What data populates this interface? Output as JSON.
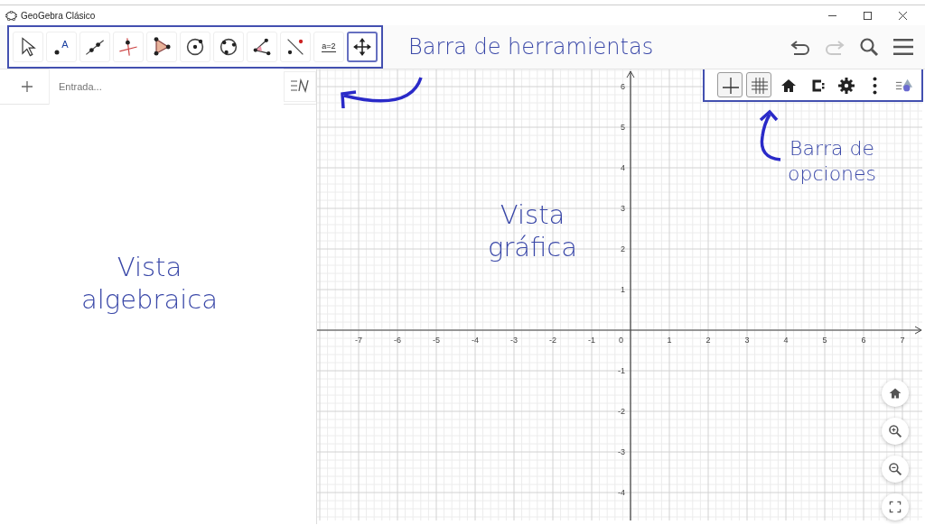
{
  "window": {
    "title": "GeoGebra Clásico"
  },
  "toolbar": {
    "tools": [
      {
        "kind": "pointer",
        "selected": false
      },
      {
        "kind": "point",
        "selected": false,
        "label": "A"
      },
      {
        "kind": "line",
        "selected": false
      },
      {
        "kind": "perpendicular",
        "selected": false
      },
      {
        "kind": "polygon",
        "selected": false
      },
      {
        "kind": "circle",
        "selected": false
      },
      {
        "kind": "circle3",
        "selected": false
      },
      {
        "kind": "angle",
        "selected": false
      },
      {
        "kind": "reflect",
        "selected": false
      },
      {
        "kind": "slider",
        "selected": false,
        "label": "a=2"
      },
      {
        "kind": "move_view",
        "selected": true
      }
    ],
    "actions": [
      {
        "kind": "undo",
        "disabled": false
      },
      {
        "kind": "redo",
        "disabled": true
      },
      {
        "kind": "search",
        "disabled": false
      },
      {
        "kind": "menu",
        "disabled": false
      }
    ]
  },
  "algebra_view": {
    "input": {
      "placeholder": "Entrada..."
    }
  },
  "graphics_view": {
    "x_ticks": [
      "-7",
      "-6",
      "-5",
      "-4",
      "-3",
      "-2",
      "-1",
      "1",
      "2",
      "3",
      "4",
      "5",
      "6",
      "7"
    ],
    "y_ticks": [
      "6",
      "5",
      "4",
      "3",
      "2",
      "1",
      "-1",
      "-2",
      "-3",
      "-4"
    ],
    "origin_label": "0",
    "style_bar": [
      {
        "kind": "axes",
        "on": true
      },
      {
        "kind": "grid",
        "on": true
      },
      {
        "kind": "home",
        "on": false
      },
      {
        "kind": "capture",
        "on": false
      },
      {
        "kind": "settings",
        "on": false
      },
      {
        "kind": "more",
        "on": false
      },
      {
        "kind": "toggle",
        "on": false
      }
    ],
    "zoom_buttons": [
      {
        "kind": "home"
      },
      {
        "kind": "zoom_in"
      },
      {
        "kind": "zoom_out"
      },
      {
        "kind": "fullscreen"
      }
    ]
  },
  "annotations": [
    {
      "kind": "toolbar",
      "text": "Barra de herramientas"
    },
    {
      "kind": "options",
      "lines": [
        "Barra de",
        "opciones"
      ]
    },
    {
      "kind": "graphics",
      "lines": [
        "Vista",
        "gráfica"
      ]
    },
    {
      "kind": "algebra",
      "lines": [
        "Vista",
        "algebraica"
      ]
    }
  ]
}
